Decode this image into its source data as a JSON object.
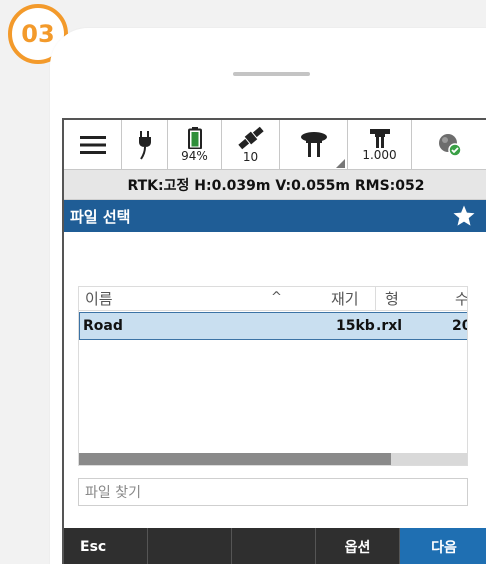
{
  "step": {
    "number": "03"
  },
  "statusbar": {
    "battery_percent": "94%",
    "satellites": "10",
    "antenna_height": "1.000"
  },
  "infobar": {
    "text": "RTK:고정 H:0.039m V:0.055m RMS:052"
  },
  "title": {
    "text": "파일 선택"
  },
  "filelist": {
    "columns": {
      "name": "이름",
      "size": "재기",
      "type": "형",
      "more": "수"
    },
    "sort_indicator": "^",
    "rows": [
      {
        "name": "Road",
        "size": "15kb",
        "type": ".rxl",
        "more": "20"
      }
    ],
    "scroll_fraction": 0.8
  },
  "search": {
    "placeholder": "파일 찾기"
  },
  "bottombar": {
    "esc": "Esc",
    "options": "옵션",
    "next": "다음"
  },
  "colors": {
    "accent": "#1f5d96",
    "badge": "#f39a2b",
    "selection": "#c9dff0",
    "fix_ok": "#3aa046"
  }
}
